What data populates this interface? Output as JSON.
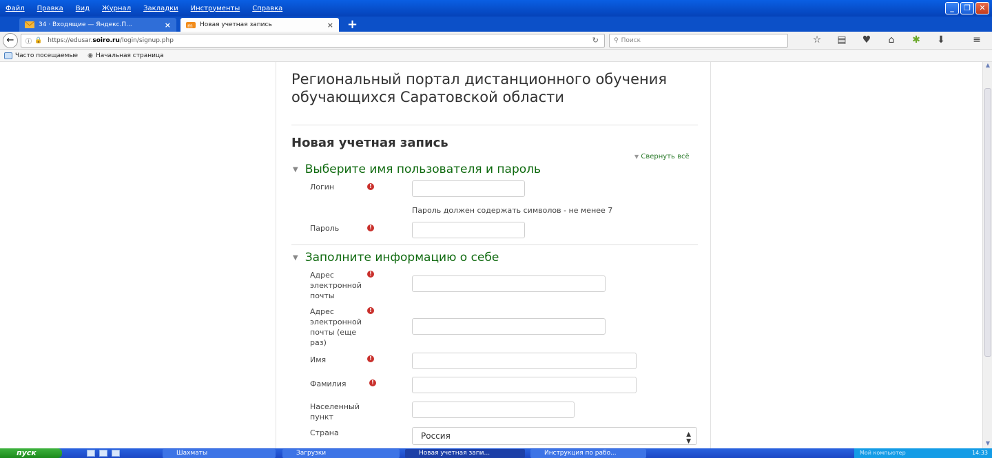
{
  "browser": {
    "menu": [
      "Файл",
      "Правка",
      "Вид",
      "Журнал",
      "Закладки",
      "Инструменты",
      "Справка"
    ],
    "tabs": [
      {
        "label": "34 · Входящие — Яндекс.П...",
        "close": "×"
      },
      {
        "label": "Новая учетная запись",
        "close": "×"
      }
    ],
    "new_tab": "+",
    "url_prefix": "https://edusar.",
    "url_host": "soiro.ru",
    "url_path": "/login/signup.php",
    "search_placeholder": "Поиск",
    "bookmarks": [
      "Часто посещаемые",
      "Начальная страница"
    ]
  },
  "page": {
    "site_title": "Региональный портал дистанционного обучения обучающихся Саратовской области",
    "heading": "Новая учетная запись",
    "collapse_all": "Свернуть всё",
    "section1": {
      "title": "Выберите имя пользователя и пароль",
      "login_label": "Логин",
      "password_hint": "Пароль должен содержать символов - не менее 7",
      "password_label": "Пароль"
    },
    "section2": {
      "title": "Заполните информацию о себе",
      "email_label": "Адрес электронной почты",
      "email2_label": "Адрес электронной почты (еще раз)",
      "firstname_label": "Имя",
      "lastname_label": "Фамилия",
      "city_label": "Населенный пункт",
      "country_label": "Страна",
      "country_value": "Россия"
    },
    "required_mark": "!"
  },
  "taskbar": {
    "start": "пуск",
    "tasks": [
      "Шахматы",
      "Загрузки",
      "Новая учетная запи...",
      "Инструкция по рабо..."
    ],
    "tray_label": "Мой компьютер",
    "clock": "14:33"
  },
  "colors": {
    "section_green": "#0f6a0f",
    "required_red": "#c9302c",
    "xp_blue": "#0c50c8"
  }
}
